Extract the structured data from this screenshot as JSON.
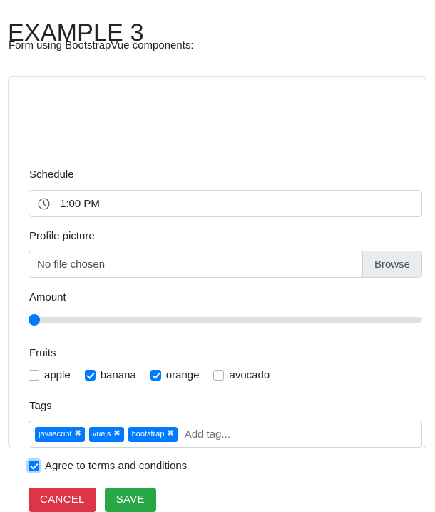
{
  "header": {
    "title": "EXAMPLE 3",
    "subtitle": "Form using BootstrapVue components:"
  },
  "form": {
    "schedule": {
      "label": "Schedule",
      "icon": "clock-icon",
      "value": "1:00 PM"
    },
    "profile_picture": {
      "label": "Profile picture",
      "placeholder": "No file chosen",
      "browse_label": "Browse"
    },
    "amount": {
      "label": "Amount",
      "value": 0,
      "min": 0,
      "max": 100
    },
    "fruits": {
      "label": "Fruits",
      "options": [
        {
          "label": "apple",
          "checked": false
        },
        {
          "label": "banana",
          "checked": true
        },
        {
          "label": "orange",
          "checked": true
        },
        {
          "label": "avocado",
          "checked": false
        }
      ]
    },
    "tags": {
      "label": "Tags",
      "values": [
        "javascript",
        "vuejs",
        "bootstrap"
      ],
      "remove_glyph": "✖",
      "placeholder": "Add tag..."
    },
    "terms": {
      "label": "Agree to terms and conditions",
      "checked": true
    },
    "actions": {
      "cancel_label": "CANCEL",
      "save_label": "SAVE"
    }
  },
  "colors": {
    "primary": "#007bff",
    "danger": "#dc3545",
    "success": "#28a745",
    "border": "#ced4da",
    "track": "#dee2e6",
    "muted": "#6c757d"
  }
}
